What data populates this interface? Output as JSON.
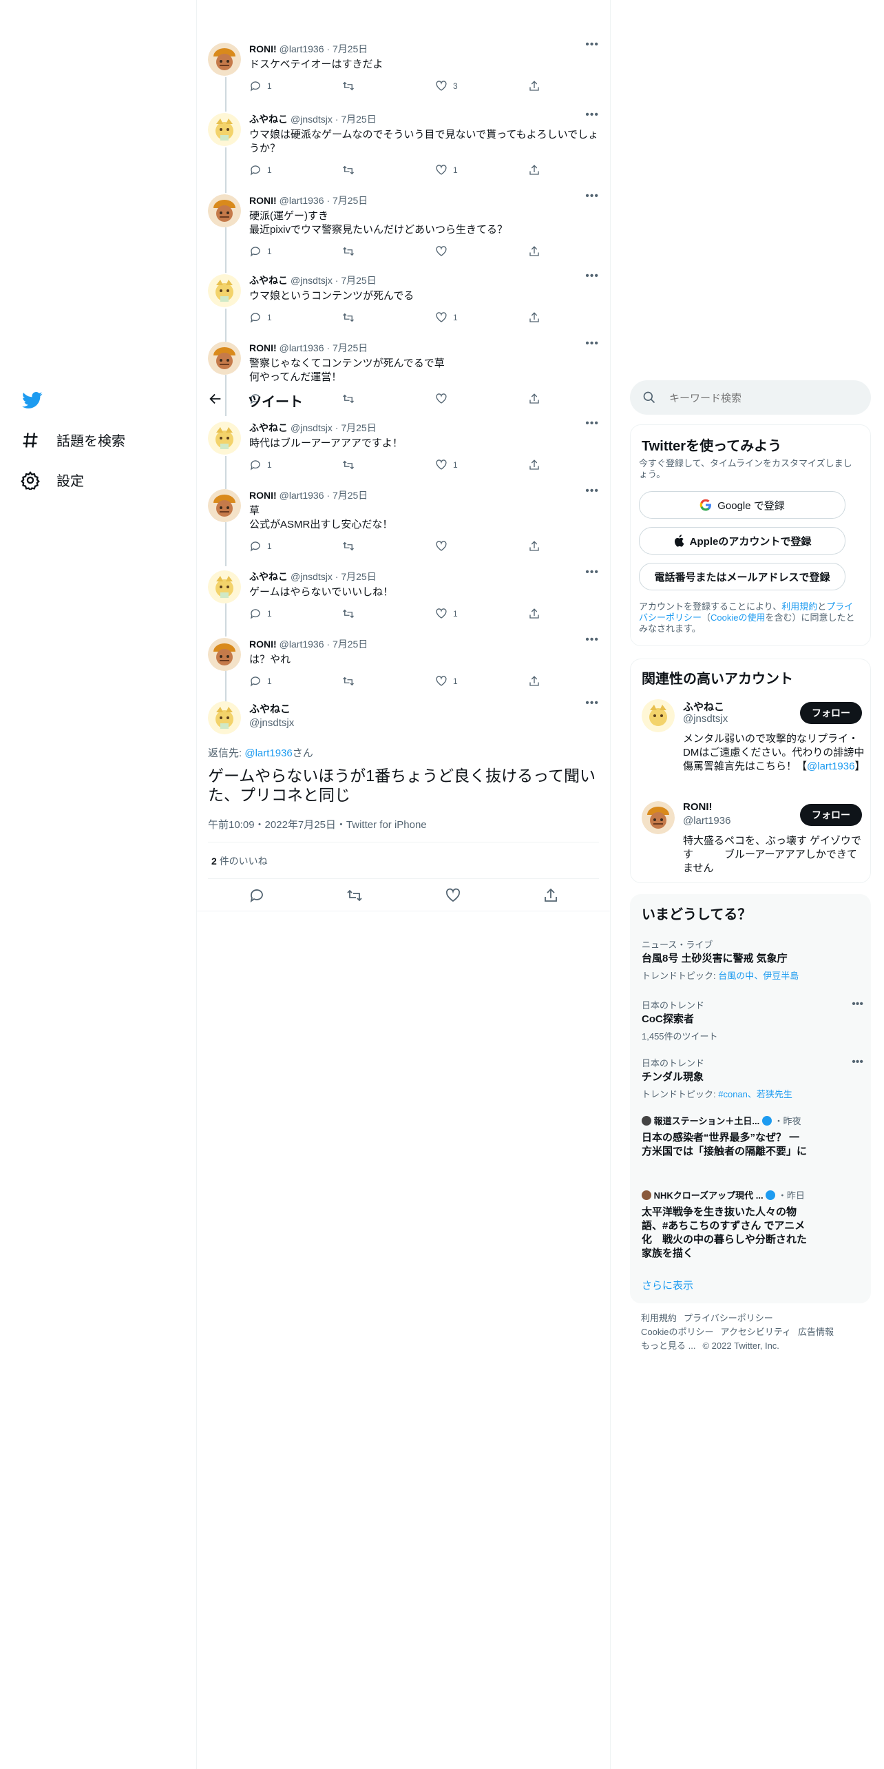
{
  "nav": {
    "explore_label": "話題を検索",
    "settings_label": "設定"
  },
  "header": {
    "title": "ツイート"
  },
  "thread": [
    {
      "name": "RONI!",
      "handle": "@lart1936",
      "date": "7月25日",
      "text": "ドスケベテイオーはすきだよ",
      "reply": "1",
      "retweet": "",
      "like": "3",
      "avatar": "roni"
    },
    {
      "name": "ふやねこ",
      "handle": "@jnsdtsjx",
      "date": "7月25日",
      "text": "ウマ娘は硬派なゲームなのでそういう目で見ないで貰ってもよろしいでしょうか？",
      "reply": "1",
      "retweet": "",
      "like": "1",
      "avatar": "fuya"
    },
    {
      "name": "RONI!",
      "handle": "@lart1936",
      "date": "7月25日",
      "text": "硬派(運ゲー)すき\n最近pixivでウマ警察見たいんだけどあいつら生きてる？",
      "reply": "1",
      "retweet": "",
      "like": "",
      "avatar": "roni"
    },
    {
      "name": "ふやねこ",
      "handle": "@jnsdtsjx",
      "date": "7月25日",
      "text": "ウマ娘というコンテンツが死んでる",
      "reply": "1",
      "retweet": "",
      "like": "1",
      "avatar": "fuya"
    },
    {
      "name": "RONI!",
      "handle": "@lart1936",
      "date": "7月25日",
      "text": "警察じゃなくてコンテンツが死んでるで草\n何やってんだ運営！",
      "reply": "",
      "retweet": "",
      "like": "",
      "avatar": "roni"
    },
    {
      "name": "ふやねこ",
      "handle": "@jnsdtsjx",
      "date": "7月25日",
      "text": "時代はブルーアーアアアですよ！",
      "reply": "1",
      "retweet": "",
      "like": "1",
      "avatar": "fuya"
    },
    {
      "name": "RONI!",
      "handle": "@lart1936",
      "date": "7月25日",
      "text": "草\n公式がASMR出すし安心だな！",
      "reply": "1",
      "retweet": "",
      "like": "",
      "avatar": "roni"
    },
    {
      "name": "ふやねこ",
      "handle": "@jnsdtsjx",
      "date": "7月25日",
      "text": "ゲームはやらないでいいしね！",
      "reply": "1",
      "retweet": "",
      "like": "1",
      "avatar": "fuya"
    },
    {
      "name": "RONI!",
      "handle": "@lart1936",
      "date": "7月25日",
      "text": "は？やれ",
      "reply": "1",
      "retweet": "",
      "like": "1",
      "avatar": "roni"
    }
  ],
  "focus": {
    "name": "ふやねこ",
    "handle": "@jnsdtsjx",
    "reply_prefix": "返信先: ",
    "reply_at": "@lart1936",
    "reply_suffix": "さん",
    "text": "ゲームやらないほうが1番ちょうど良く抜けるって聞いた、プリコネと同じ",
    "meta": "午前10:09・2022年7月25日・Twitter for iPhone",
    "likes_count": "2",
    "likes_label": "件のいいね"
  },
  "search": {
    "placeholder": "キーワード検索"
  },
  "signup": {
    "title": "Twitterを使ってみよう",
    "subtitle": "今すぐ登録して、タイムラインをカスタマイズしましょう。",
    "google": "Google で登録",
    "apple": "Appleのアカウントで登録",
    "phone": "電話番号またはメールアドレスで登録",
    "legal_1": "アカウントを登録することにより、",
    "legal_terms": "利用規約",
    "legal_2": "と",
    "legal_privacy": "プライバシーポリシー",
    "legal_3": "（",
    "legal_cookie": "Cookieの使用",
    "legal_4": "を含む）に同意したとみなされます。"
  },
  "related": {
    "title": "関連性の高いアカウント",
    "accounts": [
      {
        "name": "ふやねこ",
        "handle": "@jnsdtsjx",
        "bio": "メンタル弱いので攻撃的なリプライ・DMはご遠慮ください。代わりの誹謗中傷罵詈雑言先はこちら！【",
        "bio_link": "@lart1936",
        "bio_end": "】",
        "follow": "フォロー"
      },
      {
        "name": "RONI!",
        "handle": "@lart1936",
        "bio": "特大盛るペコを、ぶっ壊す ゲイゾウです　　　ブルーアーアアアしかできてません",
        "follow": "フォロー"
      }
    ]
  },
  "trends": {
    "title": "いまどうしてる？",
    "items": [
      {
        "cat": "ニュース・ライブ",
        "title": "台風8号 土砂災害に警戒 気象庁",
        "sub_prefix": "トレンドトピック: ",
        "sub_link": "台風の中、伊豆半島"
      },
      {
        "cat": "日本のトレンド",
        "title": "CoC探索者",
        "sub": "1,455件のツイート"
      },
      {
        "cat": "日本のトレンド",
        "title": "チンダル現象",
        "sub_prefix": "トレンドトピック: ",
        "sub_link": "#conan、若狭先生"
      },
      {
        "source": "報道ステーション＋土日...",
        "time": "・昨夜",
        "title": "日本の感染者“世界最多”なぜ？ 一方米国では「接触者の隔離不要」に"
      },
      {
        "source": "NHKクローズアップ現代 ...",
        "time": "・昨日",
        "title": "太平洋戦争を生き抜いた人々の物語、#あちこちのすずさん でアニメ化　戦火の中の暮らしや分断された家族を描く"
      }
    ],
    "show_more": "さらに表示"
  },
  "footer": {
    "links": [
      "利用規約",
      "プライバシーポリシー",
      "Cookieのポリシー",
      "アクセシビリティ",
      "広告情報",
      "もっと見る ..."
    ],
    "copyright": "© 2022 Twitter, Inc."
  },
  "colors": {
    "accent": "#1d9bf0",
    "text": "#0f1419",
    "muted": "#536471"
  }
}
